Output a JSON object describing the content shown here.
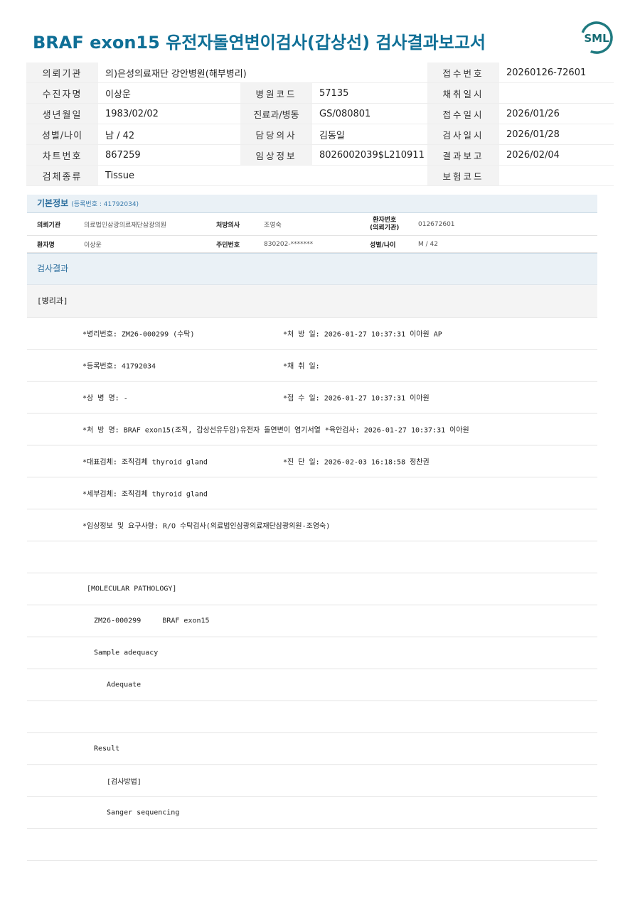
{
  "title": "BRAF exon15 유전자돌연변이검사(갑상선) 검사결과보고서",
  "logo_text": "SML",
  "colors": {
    "title": "#0f6f96",
    "accent": "#2d6f9e",
    "label_bg": "#f3f3f3"
  },
  "header": {
    "r1": {
      "l1": "의뢰기관",
      "v1": "의)은성의료재단 강안병원(해부병리)",
      "l3": "접수번호",
      "v3": "20260126-72601"
    },
    "r2": {
      "l1": "수진자명",
      "v1": "이상운",
      "l2": "병원코드",
      "v2": "57135",
      "l3": "채취일시",
      "v3": ""
    },
    "r3": {
      "l1": "생년월일",
      "v1": "1983/02/02",
      "l2": "진료과/병동",
      "v2": "GS/080801",
      "l3": "접수일시",
      "v3": "2026/01/26"
    },
    "r4": {
      "l1": "성별/나이",
      "v1": "남 / 42",
      "l2": "담당의사",
      "v2": "김동일",
      "l3": "검사일시",
      "v3": "2026/01/28"
    },
    "r5": {
      "l1": "차트번호",
      "v1": "867259",
      "l2": "임상정보",
      "v2": "8026002039$L210911",
      "l3": "결과보고",
      "v3": "2026/02/04"
    },
    "r6": {
      "l1": "검체종류",
      "v1": "Tissue",
      "l3": "보험코드",
      "v3": ""
    }
  },
  "basic": {
    "heading": "기본정보",
    "reg": "(등록번호 : 41792034)",
    "row1": {
      "k1": "의뢰기관",
      "v1": "의료법인삼광의료재단삼광의원",
      "k2": "처방의사",
      "v2": "조영숙",
      "k3a": "환자번호",
      "k3b": "(의뢰기관)",
      "v3": "012672601"
    },
    "row2": {
      "k1": "환자명",
      "v1": "이상운",
      "k2": "주민번호",
      "v2": "830202-*******",
      "k3": "성별/나이",
      "v3": "M / 42"
    }
  },
  "results": {
    "heading": "검사결과",
    "dept": "[병리과]",
    "lines": [
      {
        "a": "*병리번호: ZM26-000299 (수탁)",
        "b": "*처 방 일: 2026-01-27 10:37:31  이아원 AP"
      },
      {
        "a": "*등록번호: 41792034",
        "b": "*채 취 일:"
      },
      {
        "a": "*상 병 명: -",
        "b": "*접 수 일: 2026-01-27 10:37:31  이아원"
      },
      {
        "a": "*처 방 명: BRAF exon15(조직, 갑상선유두암)유전자 돌연변이 염기서열  *육안검사: 2026-01-27 10:37:31  이아원",
        "b": ""
      },
      {
        "a": "*대표검체: 조직검체 thyroid gland",
        "b": "*진 단 일: 2026-02-03 16:18:58  정찬권"
      },
      {
        "a": "*세부검체: 조직검체 thyroid gland",
        "b": ""
      },
      {
        "a": "*임상정보 및 요구사항: R/O 수탁검사(의료법인삼광의료재단삼광의원-조영숙)",
        "b": ""
      },
      {
        "a": "",
        "b": ""
      }
    ],
    "mol": [
      "[MOLECULAR PATHOLOGY]",
      "ZM26-000299     BRAF exon15",
      "Sample adequacy",
      "Adequate",
      "",
      "Result",
      "[검사방법]",
      "Sanger sequencing",
      ""
    ]
  }
}
